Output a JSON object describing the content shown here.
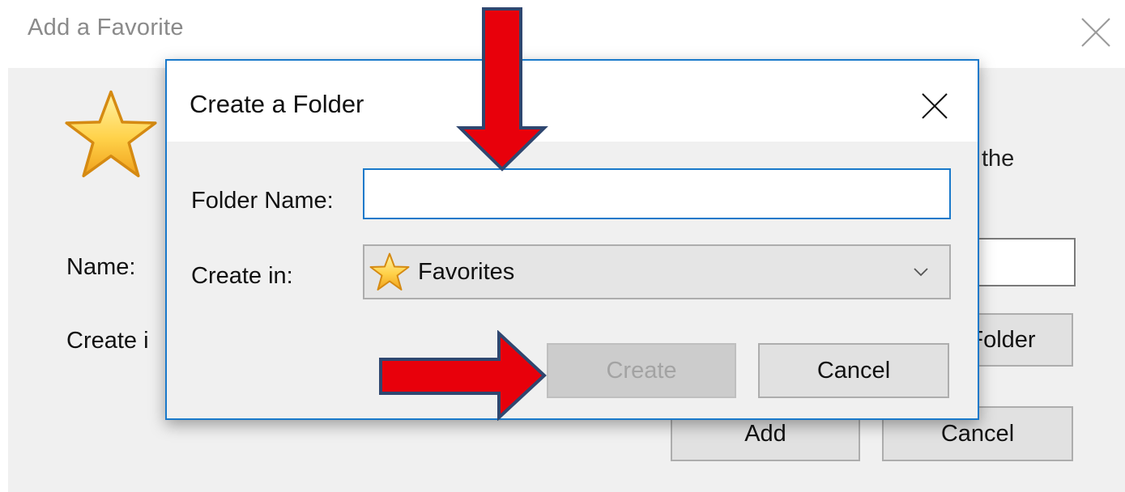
{
  "background_dialog": {
    "title": "Add a Favorite",
    "description_fragment": "the",
    "name_label": "Name:",
    "create_in_label": "Create i",
    "new_folder_button": "Folder",
    "add_button": "Add",
    "cancel_button": "Cancel"
  },
  "create_folder_dialog": {
    "title": "Create a Folder",
    "folder_name_label": "Folder Name:",
    "folder_name_value": "",
    "create_in_label": "Create in:",
    "create_in_selected": "Favorites",
    "create_button": "Create",
    "cancel_button": "Cancel",
    "create_button_enabled": false
  },
  "icons": {
    "close": "close-icon",
    "star": "star-icon",
    "chevron": "chevron-down-icon"
  },
  "colors": {
    "accent_border": "#1979ca",
    "dialog_background": "#f0f0f0",
    "annotation_arrow": "#e8000b",
    "annotation_arrow_outline": "#2f4770"
  }
}
